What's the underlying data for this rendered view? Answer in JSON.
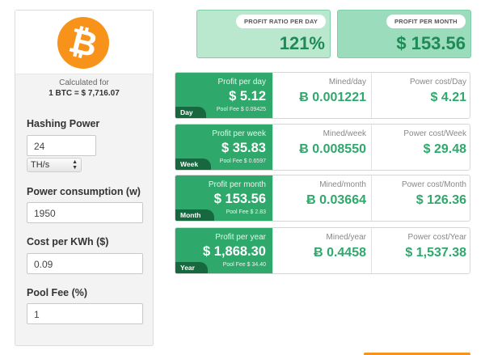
{
  "sidebar": {
    "logo_glyph": "₿",
    "calculated_for_label": "Calculated for",
    "calculated_for_value": "1 BTC = $ 7,716.07",
    "hashing_power_label": "Hashing Power",
    "hashing_power_value": "24",
    "hashing_unit": "TH/s",
    "power_consumption_label": "Power consumption (w)",
    "power_consumption_value": "1950",
    "cost_per_kwh_label": "Cost per KWh ($)",
    "cost_per_kwh_value": "0.09",
    "pool_fee_label": "Pool Fee (%)",
    "pool_fee_value": "1"
  },
  "summary": {
    "ratio_label": "PROFIT RATIO PER DAY",
    "ratio_value": "121%",
    "month_label": "PROFIT PER MONTH",
    "month_value": "$ 153.56"
  },
  "rows": [
    {
      "tag": "Day",
      "profit_label": "Profit per day",
      "profit": "$ 5.12",
      "pool_fee": "Pool Fee $ 0.09425",
      "mined_label": "Mined/day",
      "mined": "Ƀ 0.001221",
      "power_label": "Power cost/Day",
      "power": "$ 4.21"
    },
    {
      "tag": "Week",
      "profit_label": "Profit per week",
      "profit": "$ 35.83",
      "pool_fee": "Pool Fee $ 0.6597",
      "mined_label": "Mined/week",
      "mined": "Ƀ 0.008550",
      "power_label": "Power cost/Week",
      "power": "$ 29.48"
    },
    {
      "tag": "Month",
      "profit_label": "Profit per month",
      "profit": "$ 153.56",
      "pool_fee": "Pool Fee $ 2.83",
      "mined_label": "Mined/month",
      "mined": "Ƀ 0.03664",
      "power_label": "Power cost/Month",
      "power": "$ 126.36"
    },
    {
      "tag": "Year",
      "profit_label": "Profit per year",
      "profit": "$ 1,868.30",
      "pool_fee": "Pool Fee $ 34.40",
      "mined_label": "Mined/year",
      "mined": "Ƀ 0.4458",
      "power_label": "Power cost/Year",
      "power": "$ 1,537.38"
    }
  ],
  "colors": {
    "brand_orange": "#f7931a",
    "accent_green": "#2fa86b",
    "dark_green": "#17683f",
    "light_green": "#b9e8cf"
  }
}
